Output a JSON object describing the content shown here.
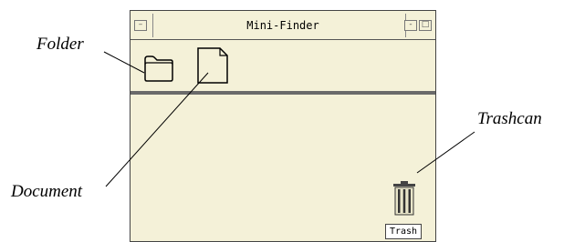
{
  "window": {
    "title": "Mini-Finder"
  },
  "callouts": {
    "folder": "Folder",
    "document": "Document",
    "trashcan": "Trashcan"
  },
  "trash": {
    "label": "Trash"
  },
  "icons": {
    "window_menu": "window-menu-icon",
    "minimize": "minimize-icon",
    "maximize": "maximize-icon",
    "folder": "folder-icon",
    "document": "document-icon",
    "trashcan": "trashcan-icon"
  },
  "colors": {
    "window_background": "#f4f1d8",
    "divider": "#6a6a6a"
  }
}
